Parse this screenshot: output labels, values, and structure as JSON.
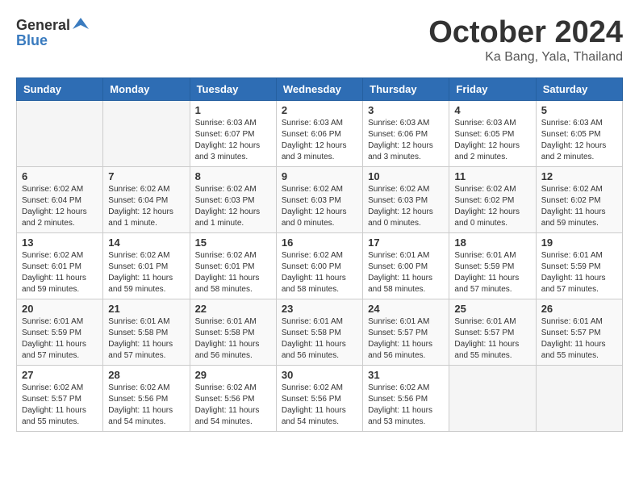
{
  "logo": {
    "general": "General",
    "blue": "Blue"
  },
  "title": {
    "month": "October 2024",
    "location": "Ka Bang, Yala, Thailand"
  },
  "weekdays": [
    "Sunday",
    "Monday",
    "Tuesday",
    "Wednesday",
    "Thursday",
    "Friday",
    "Saturday"
  ],
  "weeks": [
    [
      {
        "day": "",
        "info": ""
      },
      {
        "day": "",
        "info": ""
      },
      {
        "day": "1",
        "info": "Sunrise: 6:03 AM\nSunset: 6:07 PM\nDaylight: 12 hours\nand 3 minutes."
      },
      {
        "day": "2",
        "info": "Sunrise: 6:03 AM\nSunset: 6:06 PM\nDaylight: 12 hours\nand 3 minutes."
      },
      {
        "day": "3",
        "info": "Sunrise: 6:03 AM\nSunset: 6:06 PM\nDaylight: 12 hours\nand 3 minutes."
      },
      {
        "day": "4",
        "info": "Sunrise: 6:03 AM\nSunset: 6:05 PM\nDaylight: 12 hours\nand 2 minutes."
      },
      {
        "day": "5",
        "info": "Sunrise: 6:03 AM\nSunset: 6:05 PM\nDaylight: 12 hours\nand 2 minutes."
      }
    ],
    [
      {
        "day": "6",
        "info": "Sunrise: 6:02 AM\nSunset: 6:04 PM\nDaylight: 12 hours\nand 2 minutes."
      },
      {
        "day": "7",
        "info": "Sunrise: 6:02 AM\nSunset: 6:04 PM\nDaylight: 12 hours\nand 1 minute."
      },
      {
        "day": "8",
        "info": "Sunrise: 6:02 AM\nSunset: 6:03 PM\nDaylight: 12 hours\nand 1 minute."
      },
      {
        "day": "9",
        "info": "Sunrise: 6:02 AM\nSunset: 6:03 PM\nDaylight: 12 hours\nand 0 minutes."
      },
      {
        "day": "10",
        "info": "Sunrise: 6:02 AM\nSunset: 6:03 PM\nDaylight: 12 hours\nand 0 minutes."
      },
      {
        "day": "11",
        "info": "Sunrise: 6:02 AM\nSunset: 6:02 PM\nDaylight: 12 hours\nand 0 minutes."
      },
      {
        "day": "12",
        "info": "Sunrise: 6:02 AM\nSunset: 6:02 PM\nDaylight: 11 hours\nand 59 minutes."
      }
    ],
    [
      {
        "day": "13",
        "info": "Sunrise: 6:02 AM\nSunset: 6:01 PM\nDaylight: 11 hours\nand 59 minutes."
      },
      {
        "day": "14",
        "info": "Sunrise: 6:02 AM\nSunset: 6:01 PM\nDaylight: 11 hours\nand 59 minutes."
      },
      {
        "day": "15",
        "info": "Sunrise: 6:02 AM\nSunset: 6:01 PM\nDaylight: 11 hours\nand 58 minutes."
      },
      {
        "day": "16",
        "info": "Sunrise: 6:02 AM\nSunset: 6:00 PM\nDaylight: 11 hours\nand 58 minutes."
      },
      {
        "day": "17",
        "info": "Sunrise: 6:01 AM\nSunset: 6:00 PM\nDaylight: 11 hours\nand 58 minutes."
      },
      {
        "day": "18",
        "info": "Sunrise: 6:01 AM\nSunset: 5:59 PM\nDaylight: 11 hours\nand 57 minutes."
      },
      {
        "day": "19",
        "info": "Sunrise: 6:01 AM\nSunset: 5:59 PM\nDaylight: 11 hours\nand 57 minutes."
      }
    ],
    [
      {
        "day": "20",
        "info": "Sunrise: 6:01 AM\nSunset: 5:59 PM\nDaylight: 11 hours\nand 57 minutes."
      },
      {
        "day": "21",
        "info": "Sunrise: 6:01 AM\nSunset: 5:58 PM\nDaylight: 11 hours\nand 57 minutes."
      },
      {
        "day": "22",
        "info": "Sunrise: 6:01 AM\nSunset: 5:58 PM\nDaylight: 11 hours\nand 56 minutes."
      },
      {
        "day": "23",
        "info": "Sunrise: 6:01 AM\nSunset: 5:58 PM\nDaylight: 11 hours\nand 56 minutes."
      },
      {
        "day": "24",
        "info": "Sunrise: 6:01 AM\nSunset: 5:57 PM\nDaylight: 11 hours\nand 56 minutes."
      },
      {
        "day": "25",
        "info": "Sunrise: 6:01 AM\nSunset: 5:57 PM\nDaylight: 11 hours\nand 55 minutes."
      },
      {
        "day": "26",
        "info": "Sunrise: 6:01 AM\nSunset: 5:57 PM\nDaylight: 11 hours\nand 55 minutes."
      }
    ],
    [
      {
        "day": "27",
        "info": "Sunrise: 6:02 AM\nSunset: 5:57 PM\nDaylight: 11 hours\nand 55 minutes."
      },
      {
        "day": "28",
        "info": "Sunrise: 6:02 AM\nSunset: 5:56 PM\nDaylight: 11 hours\nand 54 minutes."
      },
      {
        "day": "29",
        "info": "Sunrise: 6:02 AM\nSunset: 5:56 PM\nDaylight: 11 hours\nand 54 minutes."
      },
      {
        "day": "30",
        "info": "Sunrise: 6:02 AM\nSunset: 5:56 PM\nDaylight: 11 hours\nand 54 minutes."
      },
      {
        "day": "31",
        "info": "Sunrise: 6:02 AM\nSunset: 5:56 PM\nDaylight: 11 hours\nand 53 minutes."
      },
      {
        "day": "",
        "info": ""
      },
      {
        "day": "",
        "info": ""
      }
    ]
  ]
}
